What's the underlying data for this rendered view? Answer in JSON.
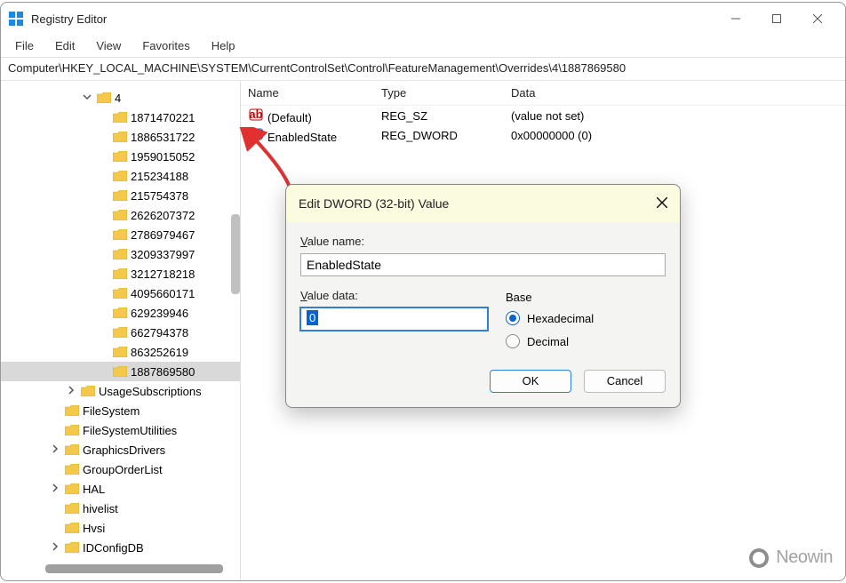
{
  "window": {
    "title": "Registry Editor"
  },
  "menu": {
    "file": "File",
    "edit": "Edit",
    "view": "View",
    "favorites": "Favorites",
    "help": "Help"
  },
  "address": "Computer\\HKEY_LOCAL_MACHINE\\SYSTEM\\CurrentControlSet\\Control\\FeatureManagement\\Overrides\\4\\1887869580",
  "tree": [
    {
      "indent": 5,
      "expander": "v",
      "label": "4",
      "type": "folder"
    },
    {
      "indent": 6,
      "label": "1871470221"
    },
    {
      "indent": 6,
      "label": "1886531722"
    },
    {
      "indent": 6,
      "label": "1959015052"
    },
    {
      "indent": 6,
      "label": "215234188"
    },
    {
      "indent": 6,
      "label": "215754378"
    },
    {
      "indent": 6,
      "label": "2626207372"
    },
    {
      "indent": 6,
      "label": "2786979467"
    },
    {
      "indent": 6,
      "label": "3209337997"
    },
    {
      "indent": 6,
      "label": "3212718218"
    },
    {
      "indent": 6,
      "label": "4095660171"
    },
    {
      "indent": 6,
      "label": "629239946"
    },
    {
      "indent": 6,
      "label": "662794378"
    },
    {
      "indent": 6,
      "label": "863252619"
    },
    {
      "indent": 6,
      "label": "1887869580",
      "selected": true
    },
    {
      "indent": 4,
      "expander": ">",
      "label": "UsageSubscriptions"
    },
    {
      "indent": 3,
      "label": "FileSystem"
    },
    {
      "indent": 3,
      "label": "FileSystemUtilities"
    },
    {
      "indent": 3,
      "expander": ">",
      "label": "GraphicsDrivers"
    },
    {
      "indent": 3,
      "label": "GroupOrderList"
    },
    {
      "indent": 3,
      "expander": ">",
      "label": "HAL"
    },
    {
      "indent": 3,
      "label": "hivelist"
    },
    {
      "indent": 3,
      "label": "Hvsi"
    },
    {
      "indent": 3,
      "expander": ">",
      "label": "IDConfigDB"
    }
  ],
  "list": {
    "columns": {
      "name": "Name",
      "type": "Type",
      "data": "Data"
    },
    "rows": [
      {
        "icon": "string",
        "name": "(Default)",
        "type": "REG_SZ",
        "data": "(value not set)"
      },
      {
        "icon": "dword",
        "name": "EnabledState",
        "type": "REG_DWORD",
        "data": "0x00000000 (0)"
      }
    ]
  },
  "dialog": {
    "title": "Edit DWORD (32-bit) Value",
    "valueNameLabel": "Value name:",
    "valueName": "EnabledState",
    "valueDataLabel": "Value data:",
    "valueData": "0",
    "baseLabel": "Base",
    "hexLabel": "Hexadecimal",
    "decLabel": "Decimal",
    "ok": "OK",
    "cancel": "Cancel"
  },
  "watermark": "Neowin"
}
